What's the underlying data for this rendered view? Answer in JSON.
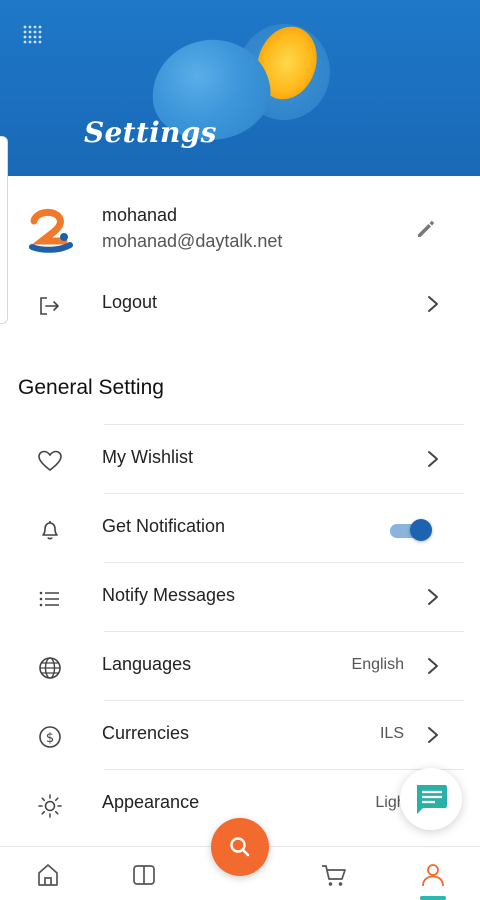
{
  "header": {
    "title": "Settings"
  },
  "profile": {
    "name": "mohanad",
    "email": "mohanad@daytalk.net"
  },
  "logout": {
    "label": "Logout"
  },
  "general": {
    "title": "General Setting",
    "items": [
      {
        "label": "My Wishlist",
        "icon": "heart-icon"
      },
      {
        "label": "Get Notification",
        "icon": "bell-icon",
        "toggle": true
      },
      {
        "label": "Notify Messages",
        "icon": "list-icon"
      },
      {
        "label": "Languages",
        "icon": "globe-icon",
        "value": "English"
      },
      {
        "label": "Currencies",
        "icon": "dollar-circle-icon",
        "value": "ILS"
      },
      {
        "label": "Appearance",
        "icon": "sun-icon",
        "value": "Light T"
      }
    ]
  },
  "bottom_nav": {
    "items": [
      "home-icon",
      "catalog-icon",
      "search-icon",
      "cart-icon",
      "profile-icon"
    ],
    "active": "profile-icon"
  },
  "colors": {
    "header": "#1f78c8",
    "accent": "#f26a2e",
    "toggle": "#1e63b0",
    "active_tab": "#2bb8b0"
  }
}
